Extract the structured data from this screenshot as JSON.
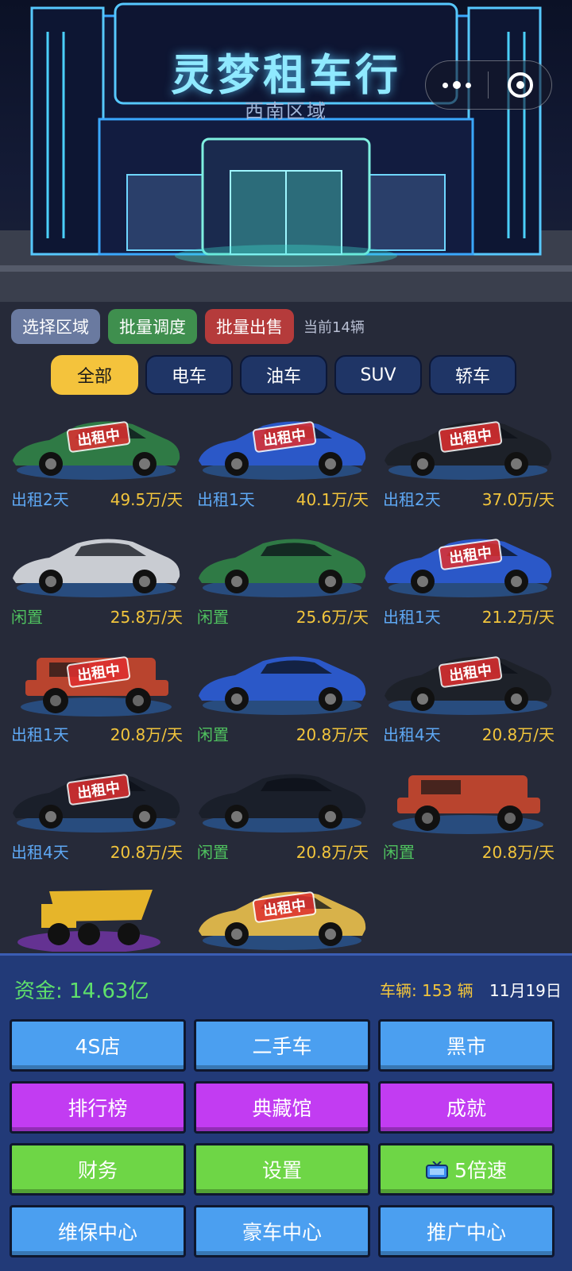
{
  "header": {
    "title": "灵梦租车行",
    "subtitle": "西南区域"
  },
  "toolbar": {
    "region_label": "选择区域",
    "dispatch_label": "批量调度",
    "sell_label": "批量出售",
    "count_text": "当前14辆"
  },
  "tabs": [
    "全部",
    "电车",
    "油车",
    "SUV",
    "轿车"
  ],
  "active_tab": "全部",
  "rented_stamp": "出租中",
  "cars": [
    {
      "status": "出租2天",
      "price": "49.5万/天",
      "type": "sports",
      "color": "#2f7a45",
      "rented": true
    },
    {
      "status": "出租1天",
      "price": "40.1万/天",
      "type": "sports",
      "color": "#2b58c8",
      "rented": true
    },
    {
      "status": "出租2天",
      "price": "37.0万/天",
      "type": "sports",
      "color": "#1d2129",
      "rented": true
    },
    {
      "status": "闲置",
      "price": "25.8万/天",
      "type": "sports",
      "color": "#c9ccd2",
      "rented": false
    },
    {
      "status": "闲置",
      "price": "25.6万/天",
      "type": "sports",
      "color": "#2f7a45",
      "rented": false
    },
    {
      "status": "出租1天",
      "price": "21.2万/天",
      "type": "sports",
      "color": "#2b58c8",
      "rented": true
    },
    {
      "status": "出租1天",
      "price": "20.8万/天",
      "type": "suv",
      "color": "#b9442e",
      "rented": true
    },
    {
      "status": "闲置",
      "price": "20.8万/天",
      "type": "sports",
      "color": "#2b58c8",
      "rented": false
    },
    {
      "status": "出租4天",
      "price": "20.8万/天",
      "type": "sports",
      "color": "#1d2129",
      "rented": true
    },
    {
      "status": "出租4天",
      "price": "20.8万/天",
      "type": "sports",
      "color": "#1a1f2a",
      "rented": true
    },
    {
      "status": "闲置",
      "price": "20.8万/天",
      "type": "sports",
      "color": "#1a1f2a",
      "rented": false
    },
    {
      "status": "闲置",
      "price": "20.8万/天",
      "type": "suv",
      "color": "#b9442e",
      "rented": false
    },
    {
      "status": "",
      "price": "",
      "type": "truck",
      "color": "#e6b52a",
      "rented": false
    },
    {
      "status": "",
      "price": "",
      "type": "sports",
      "color": "#d8b24a",
      "rented": true
    }
  ],
  "stats": {
    "funds": "资金: 14.63亿",
    "vehicles": "车辆: 153 辆",
    "date": "11月19日"
  },
  "menu": [
    {
      "label": "4S店",
      "color": "blue"
    },
    {
      "label": "二手车",
      "color": "blue"
    },
    {
      "label": "黑市",
      "color": "blue"
    },
    {
      "label": "排行榜",
      "color": "purple"
    },
    {
      "label": "典藏馆",
      "color": "purple"
    },
    {
      "label": "成就",
      "color": "purple"
    },
    {
      "label": "财务",
      "color": "green"
    },
    {
      "label": "设置",
      "color": "green"
    },
    {
      "label": "5倍速",
      "color": "green",
      "icon": "tv-icon"
    },
    {
      "label": "维保中心",
      "color": "blue"
    },
    {
      "label": "豪车中心",
      "color": "blue"
    },
    {
      "label": "推广中心",
      "color": "blue"
    }
  ]
}
